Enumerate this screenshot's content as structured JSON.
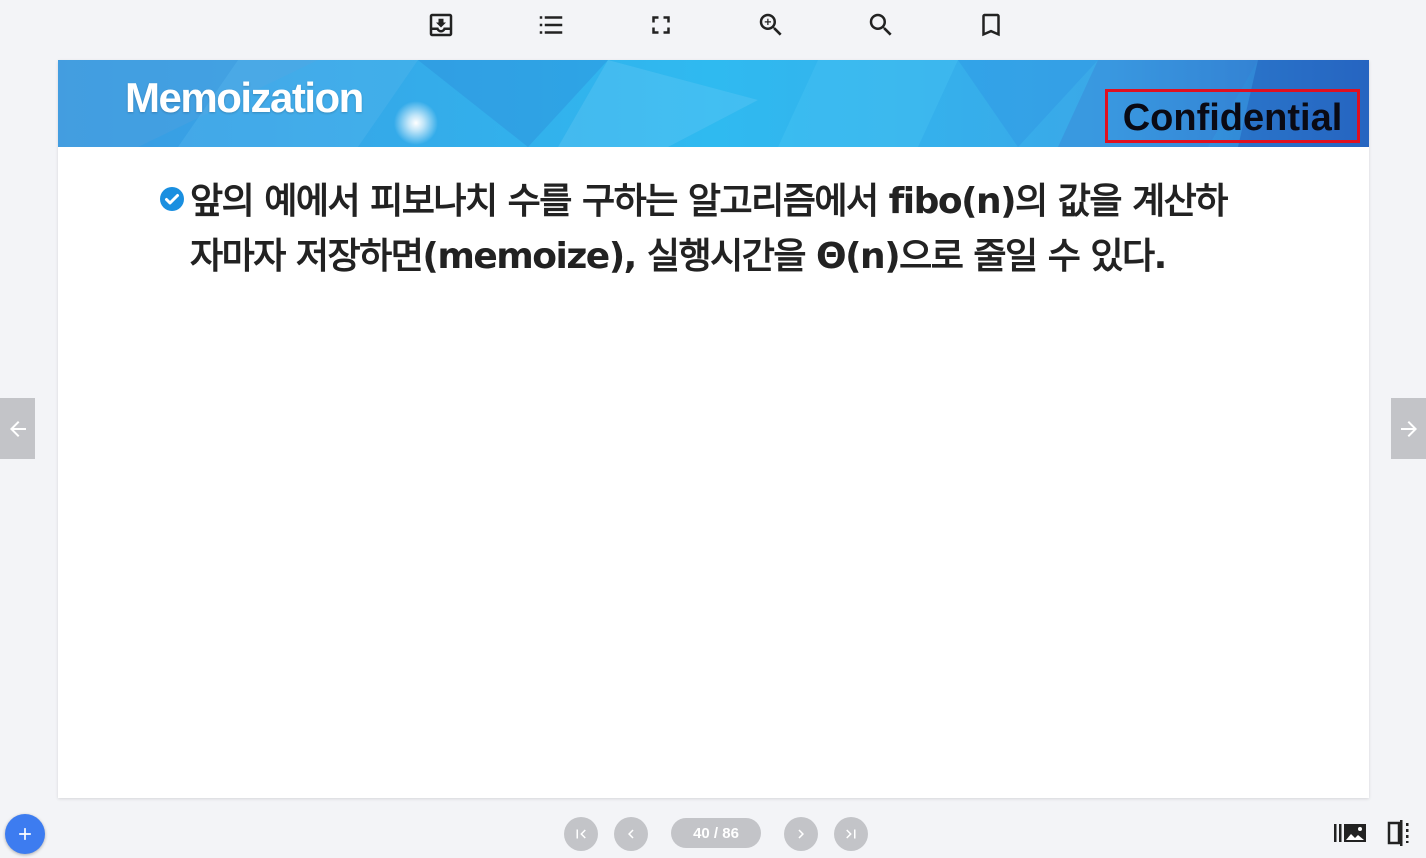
{
  "toolbar": {
    "icons": [
      "download-icon",
      "toc-list-icon",
      "fullscreen-icon",
      "zoom-in-icon",
      "search-icon",
      "bookmark-icon"
    ]
  },
  "slide": {
    "title": "Memoization",
    "stamp": "Confidential",
    "bullet_text": "앞의 예에서 피보나치 수를 구하는 알고리즘에서 fibo(n)의 값을 계산하자마자 저장하면(memoize), 실행시간을 Θ(n)으로 줄일 수 있다."
  },
  "pager": {
    "current": 40,
    "total": 86,
    "label": "40 / 86"
  },
  "colors": {
    "banner_primary": "#2fb6ee",
    "banner_dark": "#2a6fc8",
    "stamp_border": "#e01020",
    "bullet": "#1a8fe0",
    "fab": "#3d7cf0",
    "nav_gray": "#c3c4c8"
  }
}
